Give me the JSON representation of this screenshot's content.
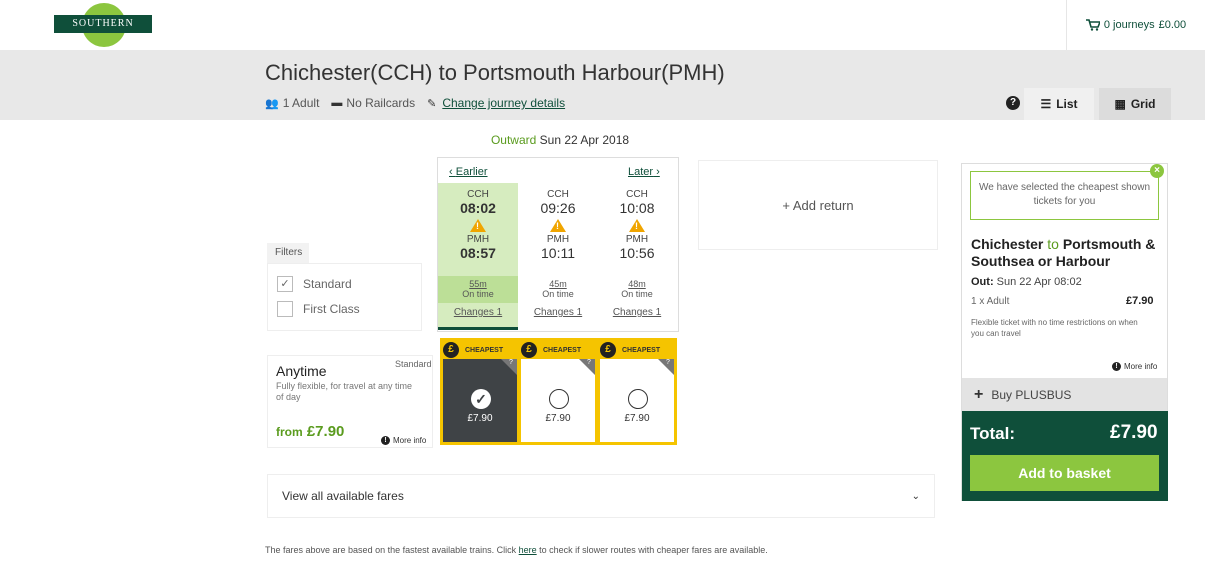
{
  "brand": {
    "logo_text": "SOUTHERN",
    "primary_color": "#0f4f3a",
    "accent_color": "#8cc63f",
    "warning_color": "#f5c400"
  },
  "cart": {
    "label": "0 journeys",
    "total": "£0.00",
    "icon": "cart-icon"
  },
  "journey": {
    "title": "Chichester(CCH) to Portsmouth Harbour(PMH)",
    "passengers": "1 Adult",
    "railcards": "No Railcards",
    "change_link": "Change journey details"
  },
  "view": {
    "list_label": "List",
    "grid_label": "Grid",
    "help": "?"
  },
  "outward": {
    "label": "Outward",
    "date": "Sun 22 Apr 2018"
  },
  "nav": {
    "earlier": "Earlier",
    "later": "Later"
  },
  "trains": [
    {
      "from": "CCH",
      "dep": "08:02",
      "to": "PMH",
      "arr": "08:57",
      "duration": "55m",
      "status": "On time",
      "changes": "Changes 1"
    },
    {
      "from": "CCH",
      "dep": "09:26",
      "to": "PMH",
      "arr": "10:11",
      "duration": "45m",
      "status": "On time",
      "changes": "Changes 1"
    },
    {
      "from": "CCH",
      "dep": "10:08",
      "to": "PMH",
      "arr": "10:56",
      "duration": "48m",
      "status": "On time",
      "changes": "Changes 1"
    }
  ],
  "add_return": "+ Add return",
  "filters": {
    "title": "Filters",
    "standard": "Standard",
    "first_class": "First Class",
    "standard_checked": true
  },
  "ticket": {
    "name": "Anytime",
    "class": "Standard",
    "description": "Fully flexible, for travel at any time of day",
    "from_label": "from",
    "price": "£7.90",
    "more_info": "More info"
  },
  "fares": [
    {
      "badge": "CHEAPEST",
      "price": "£7.90",
      "selected": true
    },
    {
      "badge": "CHEAPEST",
      "price": "£7.90",
      "selected": false
    },
    {
      "badge": "CHEAPEST",
      "price": "£7.90",
      "selected": false
    }
  ],
  "view_all": "View all available fares",
  "footnote": {
    "before": "The fares above are based on the fastest available trains. Click ",
    "link": "here",
    "after": " to check if slower routes with cheaper fares are available."
  },
  "summary": {
    "bubble": "We have selected the cheapest shown tickets for you",
    "route_from": "Chichester",
    "route_to_word": "to",
    "route_dest": "Portsmouth & Southsea or Harbour",
    "out_label": "Out:",
    "out_value": "Sun 22 Apr 08:02",
    "adult": "1 x Adult",
    "price": "£7.90",
    "flex": "Flexible ticket with no time restrictions on when you can travel",
    "more_info": "More info",
    "plusbus": "Buy PLUSBUS",
    "total_label": "Total:",
    "total_value": "£7.90",
    "basket": "Add to basket"
  }
}
